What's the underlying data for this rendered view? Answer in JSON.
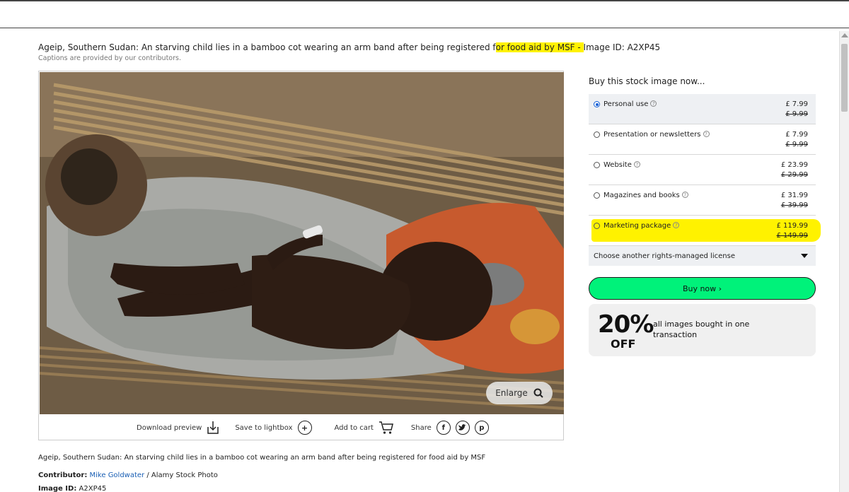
{
  "caption": {
    "part1": "Ageip, Southern Sudan: An starving child lies in a bamboo cot wearing an arm band after being registered f",
    "part2": "or ",
    "highlight": "food aid by MSF - ",
    "part3": "Image ID: A2XP45",
    "credit_note": "Captions are provided by our contributors."
  },
  "photo": {
    "enlarge_label": "Enlarge"
  },
  "actions": {
    "download_label": "Download preview",
    "lightbox_label": "Save to lightbox",
    "cart_label": "Add to cart",
    "share_label": "Share"
  },
  "description": "Ageip, Southern Sudan: An starving child lies in a bamboo cot wearing an arm band after being registered for food aid by MSF",
  "contributor": {
    "label": "Contributor:",
    "name": "Mike Goldwater",
    "agency": " / Alamy Stock Photo"
  },
  "image_id": {
    "label": "Image ID:",
    "value": "A2XP45"
  },
  "buy": {
    "title": "Buy this stock image now...",
    "options": [
      {
        "name": "Personal use",
        "price": "£ 7.99",
        "was": "£ 9.99",
        "selected": true
      },
      {
        "name": "Presentation or newsletters",
        "price": "£ 7.99",
        "was": "£ 9.99",
        "selected": false
      },
      {
        "name": "Website",
        "price": "£ 23.99",
        "was": "£ 29.99",
        "selected": false
      },
      {
        "name": "Magazines and books",
        "price": "£ 31.99",
        "was": "£ 39.99",
        "selected": false
      },
      {
        "name": "Marketing package",
        "price": "£ 119.99",
        "was": "£ 149.99",
        "selected": false
      }
    ],
    "other_license": "Choose another rights-managed license",
    "buy_now": "Buy now ›"
  },
  "promo": {
    "percent": "20%",
    "off": "OFF",
    "text": "all images bought in one transaction"
  },
  "colors": {
    "accent_green": "#00f27a",
    "highlight_yellow": "#fff200",
    "link_blue": "#1a5fb4",
    "radio_blue": "#1560d6"
  }
}
